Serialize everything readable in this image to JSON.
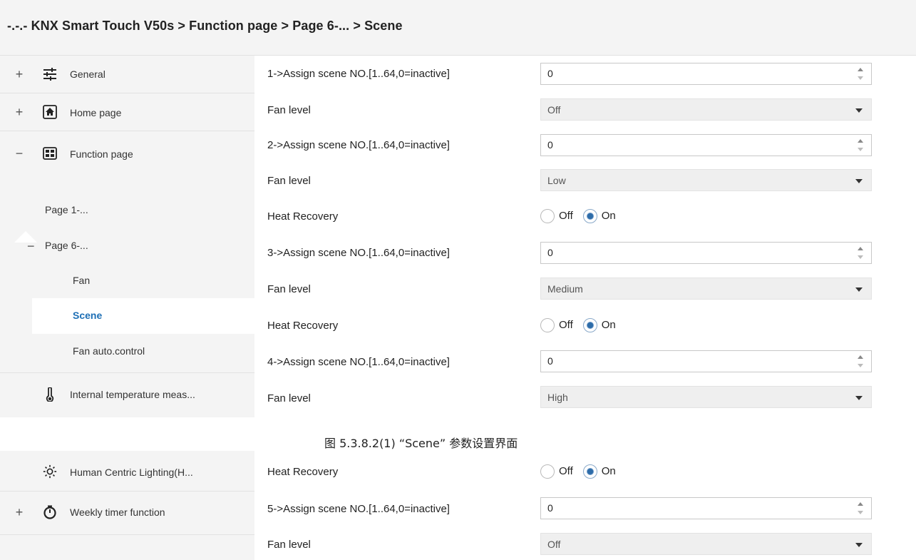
{
  "title": "-.-.- KNX Smart Touch V50s > Function page > Page 6-... > Scene",
  "sidebar": {
    "general": {
      "expander": "+",
      "label": "General",
      "icon": "sliders-icon"
    },
    "home_page": {
      "expander": "+",
      "label": "Home page",
      "icon": "home-icon"
    },
    "function_page": {
      "expander": "−",
      "label": "Function page",
      "icon": "grid-icon"
    },
    "page1": {
      "label": "Page 1-..."
    },
    "page6": {
      "expander": "−",
      "label": "Page 6-..."
    },
    "fan": {
      "label": "Fan"
    },
    "scene": {
      "label": "Scene"
    },
    "fan_auto": {
      "label": "Fan auto.control"
    },
    "internal_temp": {
      "label": "Internal temperature meas...",
      "icon": "thermometer-icon"
    },
    "hcl": {
      "label": "Human Centric Lighting(H...",
      "icon": "sun-icon"
    },
    "weekly_timer": {
      "expander": "+",
      "label": "Weekly timer function",
      "icon": "timer-icon"
    }
  },
  "params": {
    "s1_assign": {
      "label": "1->Assign scene NO.[1..64,0=inactive]",
      "value": "0"
    },
    "s1_fan": {
      "label": "Fan level",
      "value": "Off"
    },
    "s2_assign": {
      "label": "2->Assign scene NO.[1..64,0=inactive]",
      "value": "0"
    },
    "s2_fan": {
      "label": "Fan level",
      "value": "Low"
    },
    "s2_heat": {
      "label": "Heat Recovery",
      "off": "Off",
      "on": "On",
      "selected": "On"
    },
    "s3_assign": {
      "label": "3->Assign scene NO.[1..64,0=inactive]",
      "value": "0"
    },
    "s3_fan": {
      "label": "Fan level",
      "value": "Medium"
    },
    "s3_heat": {
      "label": "Heat Recovery",
      "off": "Off",
      "on": "On",
      "selected": "On"
    },
    "s4_assign": {
      "label": "4->Assign scene NO.[1..64,0=inactive]",
      "value": "0"
    },
    "s4_fan": {
      "label": "Fan level",
      "value": "High"
    },
    "s4_heat": {
      "label": "Heat Recovery",
      "off": "Off",
      "on": "On",
      "selected": "On"
    },
    "s5_assign": {
      "label": "5->Assign scene NO.[1..64,0=inactive]",
      "value": "0"
    },
    "s5_fan": {
      "label": "Fan level",
      "value": "Off"
    }
  },
  "caption": "图 5.3.8.2(1) “Scene” 参数设置界面",
  "colors": {
    "accent": "#1d6fb5",
    "sidebar_bg": "#f4f4f4",
    "dropdown_bg": "#efefef"
  }
}
